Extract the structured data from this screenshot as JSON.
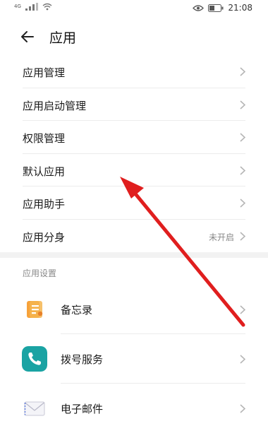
{
  "status_bar": {
    "network": "4G",
    "time": "21:08"
  },
  "header": {
    "title": "应用"
  },
  "menu": {
    "items": [
      {
        "label": "应用管理",
        "value": ""
      },
      {
        "label": "应用启动管理",
        "value": ""
      },
      {
        "label": "权限管理",
        "value": ""
      },
      {
        "label": "默认应用",
        "value": ""
      },
      {
        "label": "应用助手",
        "value": ""
      },
      {
        "label": "应用分身",
        "value": "未开启"
      }
    ]
  },
  "app_settings": {
    "section_title": "应用设置",
    "apps": [
      {
        "label": "备忘录",
        "icon": "notepad-icon"
      },
      {
        "label": "拨号服务",
        "icon": "phone-icon"
      },
      {
        "label": "电子邮件",
        "icon": "email-icon"
      }
    ]
  },
  "colors": {
    "annotation_arrow": "#e01e1e",
    "notepad_icon": "#f39a2e",
    "phone_icon": "#1aa3a3",
    "chevron": "#b5b5b5"
  }
}
